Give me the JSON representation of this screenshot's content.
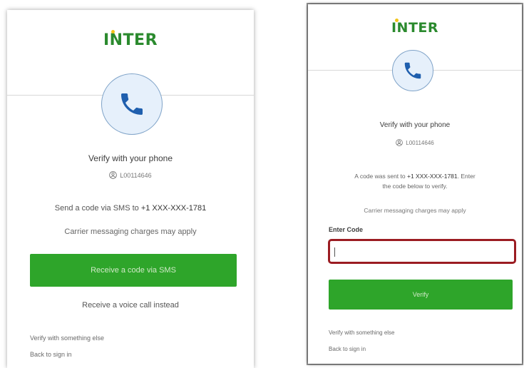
{
  "panel_a": {
    "logo": "INTER",
    "title": "Verify with your phone",
    "username": "L00114646",
    "send_text_prefix": "Send a code via SMS to",
    "phone_number": "+1 XXX-XXX-1781",
    "carrier_note": "Carrier messaging charges may apply",
    "sms_button": "Receive a code via SMS",
    "voice_link": "Receive a voice call instead",
    "other_link": "Verify with something else",
    "back_link": "Back to sign in"
  },
  "panel_b": {
    "logo": "INTER",
    "title": "Verify with your phone",
    "username": "L00114646",
    "sent_text_prefix": "A code was sent to",
    "phone_number": "+1 XXX-XXX-1781",
    "sent_text_suffix": "Enter",
    "sent_text_line2": "the code below to verify.",
    "carrier_note": "Carrier messaging charges may apply",
    "code_label": "Enter Code",
    "code_value": "",
    "verify_button": "Verify",
    "other_link": "Verify with something else",
    "back_link": "Back to sign in"
  },
  "colors": {
    "brand_green": "#2b8a2e",
    "button_green": "#2ea52a",
    "logo_dot": "#f2c418",
    "phone_icon": "#1f5fae",
    "input_highlight": "#9b1c22"
  },
  "icons": {
    "phone": "phone-icon",
    "user": "user-icon"
  }
}
